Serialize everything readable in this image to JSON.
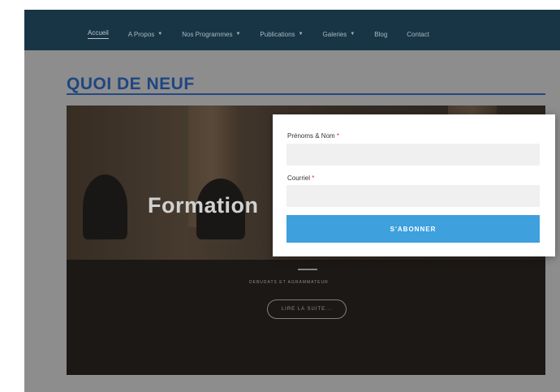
{
  "nav": {
    "items": [
      {
        "label": "Accueil",
        "caret": false,
        "active": true
      },
      {
        "label": "A Propos",
        "caret": true,
        "active": false
      },
      {
        "label": "Nos Programmes",
        "caret": true,
        "active": false
      },
      {
        "label": "Publications",
        "caret": true,
        "active": false
      },
      {
        "label": "Galeries",
        "caret": true,
        "active": false
      },
      {
        "label": "Blog",
        "caret": false,
        "active": false
      },
      {
        "label": "Contact",
        "caret": false,
        "active": false
      }
    ]
  },
  "main": {
    "section_title": "QUOI DE NEUF",
    "hero": {
      "headline": "Formation",
      "subtitle": "DEBUDATS ET AGRAMMATEUR",
      "button_label": "LIRE LA SUITE..."
    }
  },
  "subscribe_modal": {
    "name_label": "Prénoms & Nom",
    "name_required": "*",
    "name_value": "",
    "name_placeholder": "",
    "email_label": "Courriel",
    "email_required": "*",
    "email_value": "",
    "email_placeholder": "",
    "submit_label": "S'ABONNER"
  },
  "colors": {
    "topbar": "#1b3a4c",
    "title": "#214c8d",
    "accent_button": "#3ea0dd"
  }
}
